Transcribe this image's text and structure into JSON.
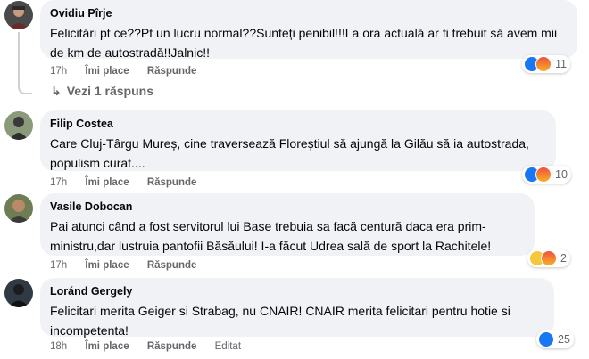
{
  "comments": [
    {
      "author": "Ovidiu Pîrje",
      "text": "Felicitări pt ce??Pt un lucru normal??Sunteți penibil!!!La ora actuală ar fi trebuit să avem mii de km de autostradă!!Jalnic!!",
      "time": "17h",
      "like_label": "Îmi place",
      "reply_label": "Răspunde",
      "reaction_count": "11",
      "reactions": [
        "like",
        "angry"
      ]
    },
    {
      "author": "Filip Costea",
      "text": "Care Cluj-Târgu Mureș, cine traversează Floreștiul să ajungă la Gilău să ia autostrada, populism curat....",
      "time": "17h",
      "like_label": "Îmi place",
      "reply_label": "Răspunde",
      "reaction_count": "10",
      "reactions": [
        "like",
        "angry"
      ]
    },
    {
      "author": "Vasile Dobocan",
      "text": "Pai atunci când a fost servitorul lui Base trebuia sa facă centură daca era prim-ministru,dar lustruia pantofii Băsăului! I-a făcut Udrea sală de sport la Rachitele!",
      "time": "17h",
      "like_label": "Îmi place",
      "reply_label": "Răspunde",
      "reaction_count": "2",
      "reactions": [
        "haha",
        "angry"
      ]
    },
    {
      "author": "Loránd Gergely",
      "text": "Felicitari merita Geiger si Strabag, nu CNAIR! CNAIR merita felicitari pentru hotie si incompetenta!",
      "time": "18h",
      "like_label": "Îmi place",
      "reply_label": "Răspunde",
      "edited_label": "Editat",
      "reaction_count": "25",
      "reactions": [
        "like"
      ]
    }
  ],
  "view_replies": "Vezi 1 răspuns",
  "colors": {
    "bubble": "#f0f2f5",
    "meta": "#65676b",
    "like": "#1877f2",
    "angry": "#f0503f",
    "haha": "#f7c63a"
  }
}
